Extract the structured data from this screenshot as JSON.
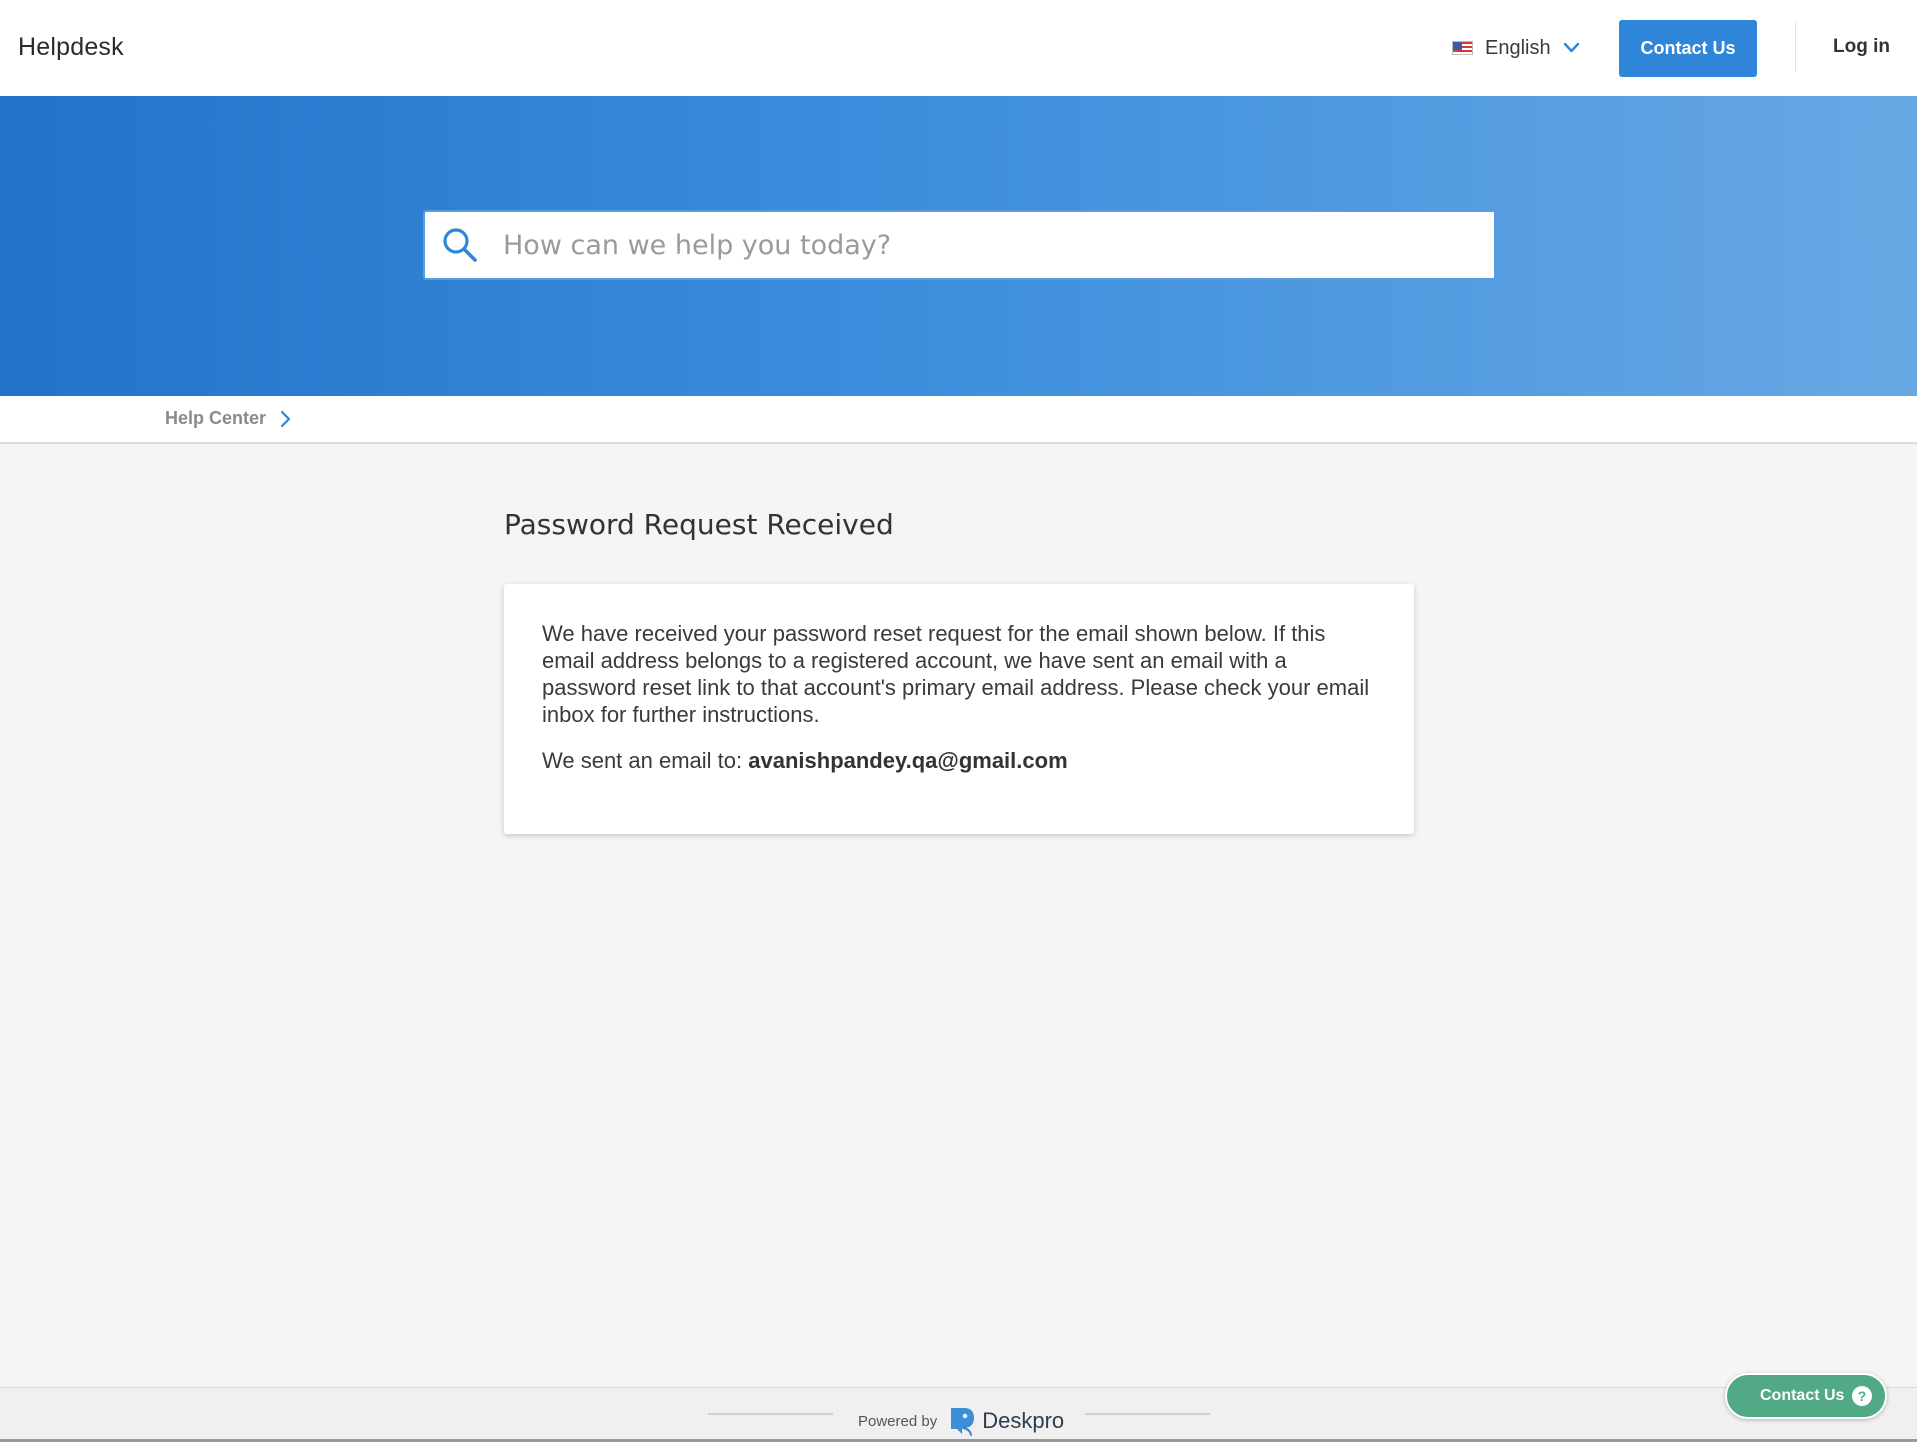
{
  "header": {
    "brand": "Helpdesk",
    "language": "English",
    "contact_label": "Contact Us",
    "login_label": "Log in"
  },
  "search": {
    "placeholder": "How can we help you today?"
  },
  "breadcrumb": {
    "items": [
      "Help Center"
    ]
  },
  "main": {
    "title": "Password Request Received",
    "message": "We have received your password reset request for the email shown below. If this email address belongs to a registered account, we have sent an email with a password reset link to that account's primary email address. Please check your email inbox for further instructions.",
    "sent_prefix": "We sent an email to:",
    "email": "avanishpandey.qa@gmail.com"
  },
  "footer": {
    "powered_by": "Powered by",
    "product": "Deskpro"
  },
  "floating": {
    "contact_label": "Contact Us"
  },
  "colors": {
    "accent": "#2f86d9",
    "hero_start": "#2373c9",
    "hero_end": "#68a8e4",
    "float_button": "#52a985"
  },
  "icons": [
    "us-flag-icon",
    "chevron-down-icon",
    "search-icon",
    "chevron-right-icon",
    "deskpro-logo-icon",
    "help-icon"
  ]
}
